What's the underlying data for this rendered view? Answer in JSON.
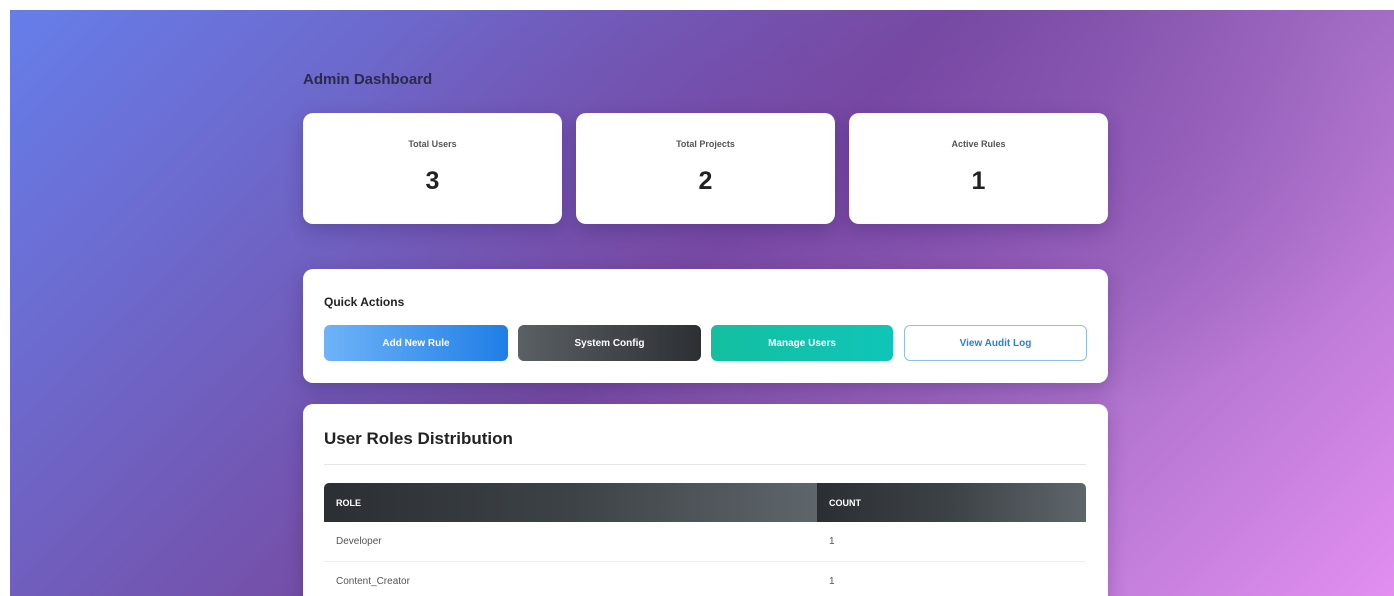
{
  "page": {
    "title": "Admin Dashboard"
  },
  "stats": [
    {
      "label": "Total Users",
      "value": "3"
    },
    {
      "label": "Total Projects",
      "value": "2"
    },
    {
      "label": "Active Rules",
      "value": "1"
    }
  ],
  "quick_actions": {
    "title": "Quick Actions",
    "buttons": [
      {
        "label": "Add New Rule"
      },
      {
        "label": "System Config"
      },
      {
        "label": "Manage Users"
      },
      {
        "label": "View Audit Log"
      }
    ]
  },
  "roles": {
    "title": "User Roles Distribution",
    "columns": [
      "ROLE",
      "COUNT"
    ],
    "rows": [
      {
        "role": "Developer",
        "count": "1"
      },
      {
        "role": "Content_Creator",
        "count": "1"
      }
    ]
  },
  "colors": {
    "gradient_start": "#667eea",
    "gradient_mid": "#764ba2",
    "gradient_end": "#e28ff0",
    "primary_button": "#1f7ee6",
    "dark_button": "#2c2f33",
    "teal_button": "#10c5b8",
    "outline_button_text": "#2d7fd6"
  }
}
